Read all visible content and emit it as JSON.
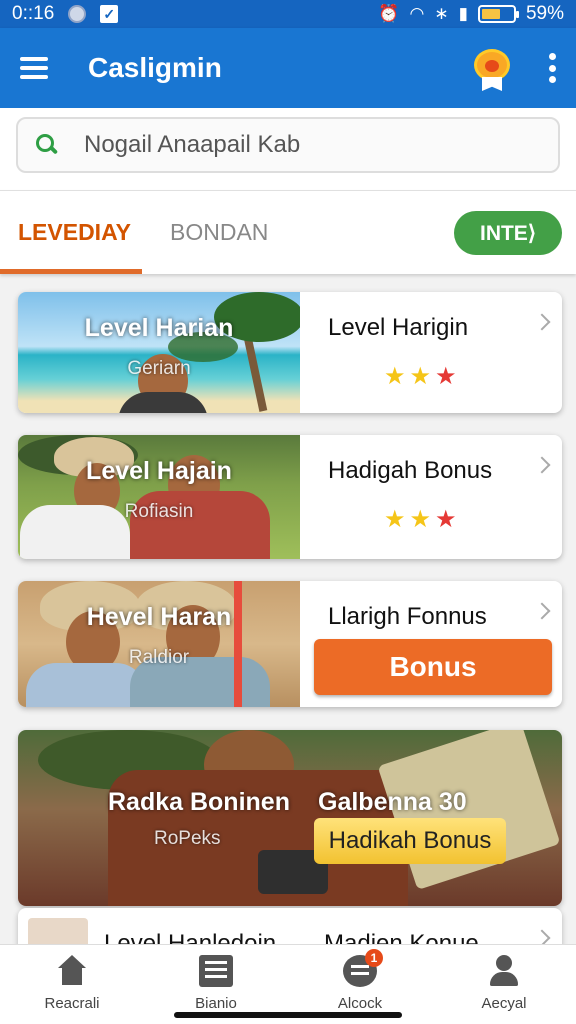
{
  "status_bar": {
    "time": "0::16",
    "battery": "59%",
    "battery_level": 0.59
  },
  "app_bar": {
    "title": "Casligmin",
    "menu_icon": "hamburger-icon",
    "badge_icon": "medal-badge-icon",
    "more_icon": "kebab-icon"
  },
  "search": {
    "placeholder": "Nogail Anaapail Kab",
    "value": ""
  },
  "tabs": {
    "active": "LEVEDIAY",
    "inactive": "BONDAN",
    "action": "INTE⟩"
  },
  "cards": [
    {
      "image_title": "Level Harian",
      "image_sub": "Geriarn",
      "title": "Level Harigin",
      "stars_filled": 3
    },
    {
      "image_title": "Level Hajain",
      "image_sub": "Rofiasin",
      "title": "Hadigah Bonus",
      "stars_filled": 3
    },
    {
      "image_title": "Hevel Haran",
      "image_sub": "Raldior",
      "title": "Llarigh Fonnus",
      "button": "Bonus"
    },
    {
      "image_title": "Radka Boninen",
      "image_sub": "RoPeks",
      "title": "Galbenna 30",
      "button": "Hadikah Bonus"
    },
    {
      "image_title": "Level Hanledoin",
      "title": "Madien Konue"
    }
  ],
  "bottom_nav": [
    {
      "label": "Reacrali",
      "icon": "home-icon"
    },
    {
      "label": "Bianio",
      "icon": "list-icon"
    },
    {
      "label": "Alcock",
      "icon": "chat-icon",
      "badge": "1"
    },
    {
      "label": "Aecyal",
      "icon": "person-icon"
    }
  ],
  "colors": {
    "primary": "#1976d2",
    "accent": "#e06b2a",
    "action_green": "#43a047"
  }
}
